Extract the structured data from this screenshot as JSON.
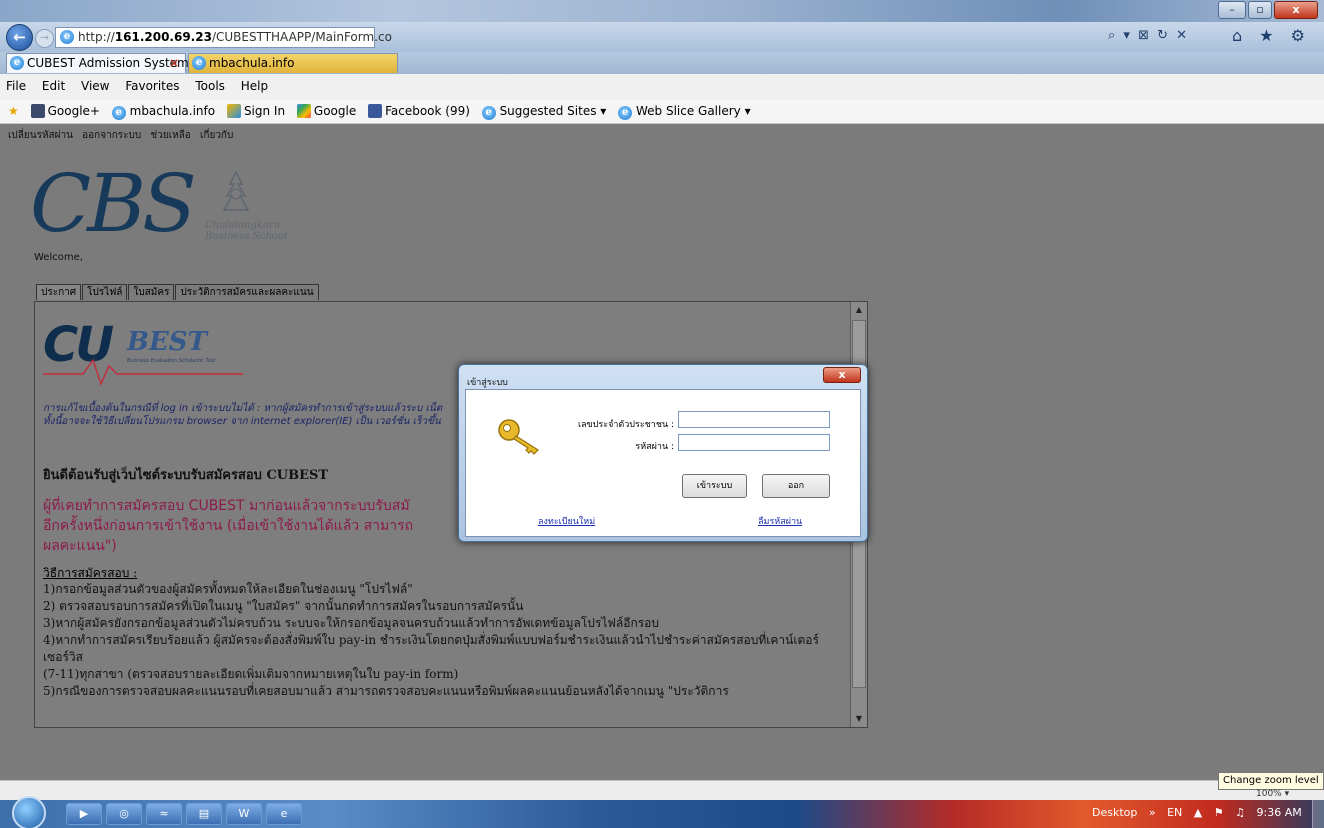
{
  "browser": {
    "url_prefix": "http://",
    "url_host": "161.200.69.23",
    "url_path": "/CUBESTTHAAPP/MainForm.co",
    "tabs": [
      "CUBEST Admission System",
      "mbachula.info"
    ],
    "tab_close": "×",
    "menu": [
      "File",
      "Edit",
      "View",
      "Favorites",
      "Tools",
      "Help"
    ],
    "favorites": [
      "Google+",
      "mbachula.info",
      "Sign In",
      "Google",
      "Facebook (99)",
      "Suggested Sites ▾",
      "Web Slice Gallery ▾"
    ],
    "search_controls": "⌕ ▾ ⊠ ↻ ✕",
    "right_icons": "⌂ ★ ⚙",
    "window_buttons": [
      "–",
      "▫",
      "x"
    ],
    "back_glyph": "←",
    "forward_glyph": "→",
    "ie_glyph": "e"
  },
  "page": {
    "top_nav": [
      "เปลี่ยนรหัสผ่าน",
      "ออกจากระบบ",
      "ช่วยเหลือ",
      "เกี่ยวกับ"
    ],
    "logo_text": "CBS",
    "logo_subtitle_1": "Chulalongkorn",
    "logo_subtitle_2": "Business School",
    "welcome": "Welcome,",
    "tabs": [
      "ประกาศ",
      "โปรไฟล์",
      "ใบสมัคร",
      "ประวัติการสมัครและผลคะแนน"
    ],
    "cubest_cu": "CU",
    "cubest_best": "BEST",
    "cubest_tagline": "Business Evaluation Scholastic Tool",
    "note": "การแก้ไขเบื้องต้นในกรณีที่ log in เข้าระบบไม่ได้ : หากผู้สมัครทำการเข้าสู่ระบบแล้วระบ เน็ต ทั้งนี้อาจจะใช้วิธีเปลี่ยนโปรแกรม browser จาก internet explorer(IE) เป็น เวอร์ชั่น เร็วขึ้น",
    "heading": "ยินดีต้อนรับสู่เว็บไซต์ระบบรับสมัครสอบ CUBEST",
    "pink_line_1": "ผู้ที่เคยทำการสมัครสอบ CUBEST มาก่อนแล้วจากระบบรับสมั",
    "pink_line_2": "อีกครั้งหนึ่งก่อนการเข้าใช้งาน (เมื่อเข้าใช้งานได้แล้ว สามารถ",
    "pink_line_3": "ผลคะแนน\")",
    "how_heading": "วิธีการสมัครสอบ :",
    "steps": [
      "1)กรอกข้อมูลส่วนตัวของผู้สมัครทั้งหมดให้ละเอียดในช่องเมนู \"โปรไฟล์\"",
      "2) ตรวจสอบรอบการสมัครที่เปิดในเมนู \"ใบสมัคร\" จากนั้นกดทำการสมัครในรอบการสมัครนั้น",
      "3)หากผู้สมัครยังกรอกข้อมูลส่วนตัวไม่ครบถ้วน ระบบจะให้กรอกข้อมูลจนครบถ้วนแล้วทำการอัพเดทข้อมูลโปรไฟล์อีกรอบ",
      "4)หากทำการสมัครเรียบร้อยแล้ว ผู้สมัครจะต้องสั่งพิมพ์ใบ pay-in ชำระเงินโดยกดปุ่มสั่งพิมพ์แบบฟอร์มชำระเงินแล้วนำไปชำระค่าสมัครสอบที่เคาน์เตอร์เซอร์วิส",
      "(7-11)ทุกสาขา (ตรวจสอบรายละเอียดเพิ่มเติมจากหมายเหตุในใบ pay-in form)",
      "5)กรณีของการตรวจสอบผลคะแนนรอบที่เคยสอบมาแล้ว สามารถตรวจสอบคะแนนหรือพิมพ์ผลคะแนนย้อนหลังได้จากเมนู \"ประวัติการ"
    ],
    "scroll_up": "▲",
    "scroll_down": "▼"
  },
  "login": {
    "title": "เข้าสู่ระบบ",
    "close_label": "x",
    "id_label": "เลขประจำตัวประชาชน :",
    "password_label": "รหัสผ่าน :",
    "id_value": "",
    "password_value": "",
    "login_button": "เข้าระบบ",
    "exit_button": "ออก",
    "register_link": "ลงทะเบียนใหม่",
    "forgot_link": "ลืมรหัสผ่าน"
  },
  "status": {
    "zoom_tooltip": "Change zoom level",
    "zoom_level": "100% ▾"
  },
  "taskbar": {
    "buttons": [
      "▶",
      "◎",
      "≈",
      "▤",
      "W",
      "e"
    ],
    "tray": [
      "Desktop",
      "»",
      "EN",
      "▲",
      "⚑",
      "♫",
      "9:36 AM"
    ]
  },
  "colors": {
    "pink_text": "#8c1b4a",
    "dialog_frame": "#a9c4e2",
    "link": "#1a2fb0"
  }
}
